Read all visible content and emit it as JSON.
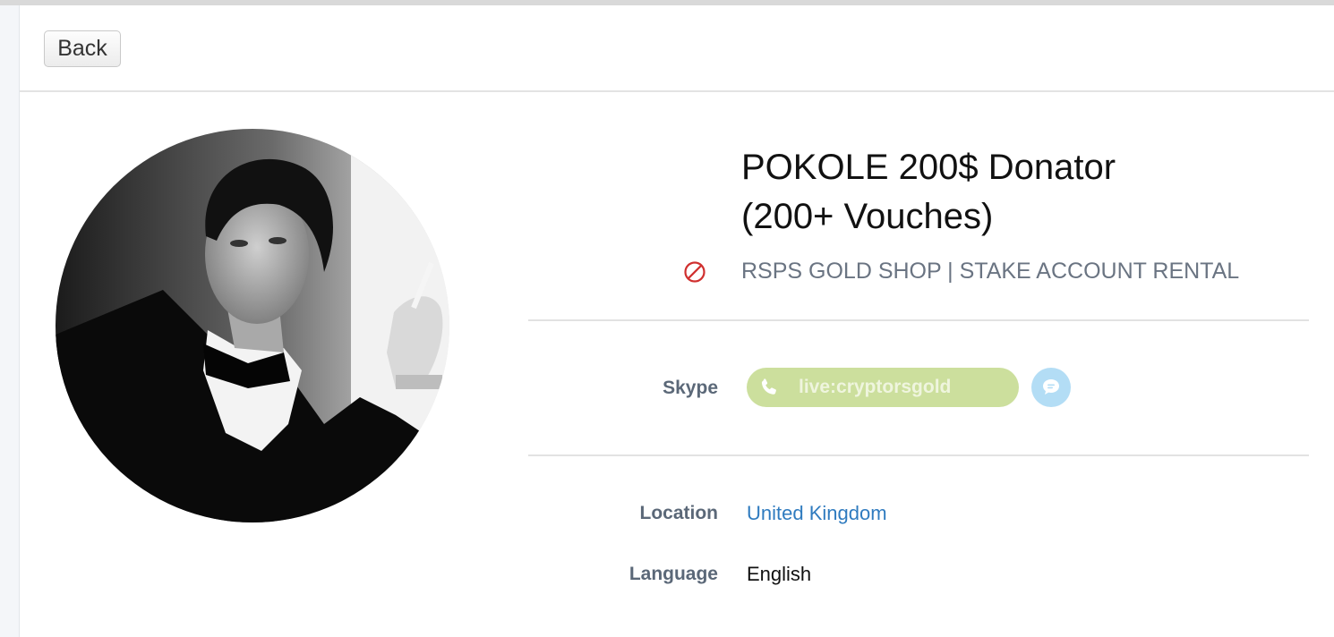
{
  "header": {
    "back_label": "Back"
  },
  "profile": {
    "avatar": "black-and-white-portrait-photo",
    "name": "POKOLE 200$ Donator\n(200+  Vouches)",
    "status_icon": "blocked-icon",
    "subtitle": "RSPS GOLD SHOP | STAKE ACCOUNT RENTAL"
  },
  "fields": {
    "skype": {
      "label": "Skype",
      "value": "live:cryptorsgold",
      "icon": "phone-icon",
      "chat_icon": "chat-bubble-icon"
    },
    "location": {
      "label": "Location",
      "value": "United Kingdom"
    },
    "language": {
      "label": "Language",
      "value": "English"
    }
  },
  "colors": {
    "skype_pill": "#ccdf9d",
    "chat_button": "#b3ddf5",
    "link": "#2f7bbf",
    "blocked": "#d0302f",
    "label": "#5b6878"
  }
}
